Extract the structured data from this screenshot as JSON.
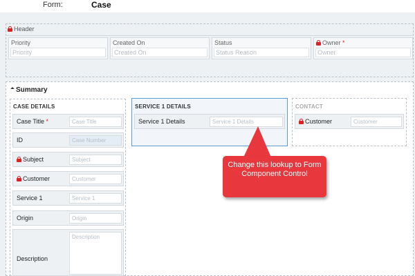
{
  "form": {
    "label": "Form:",
    "name": "Case"
  },
  "header": {
    "title": "Header",
    "fields": [
      {
        "label": "Priority",
        "placeholder": "Priority"
      },
      {
        "label": "Created On",
        "placeholder": "Created On"
      },
      {
        "label": "Status",
        "placeholder": "Status Reason"
      },
      {
        "label": "Owner",
        "placeholder": "Owner",
        "required": "*"
      }
    ]
  },
  "summary": {
    "title": "Summary",
    "case_details": {
      "title": "CASE DETAILS",
      "rows": [
        {
          "label": "Case Title",
          "placeholder": "Case Title",
          "required": "*"
        },
        {
          "label": "ID",
          "placeholder": "Case Number"
        },
        {
          "label": "Subject",
          "placeholder": "Subject"
        },
        {
          "label": "Customer",
          "placeholder": "Customer"
        },
        {
          "label": "Service 1",
          "placeholder": "Service 1"
        },
        {
          "label": "Origin",
          "placeholder": "Origin"
        },
        {
          "label": "Description",
          "placeholder": "Description"
        }
      ]
    },
    "service_details": {
      "title": "SERVICE 1 DETAILS",
      "rows": [
        {
          "label": "Service 1 Details",
          "placeholder": "Service 1 Details"
        }
      ]
    },
    "contact": {
      "title": "CONTACT",
      "rows": [
        {
          "label": "Customer",
          "placeholder": "Customer"
        }
      ]
    }
  },
  "callout": {
    "text": "Change this lookup to Form Component Control"
  },
  "colors": {
    "callout": "#e8383e",
    "required": "#dd2222",
    "selected_border": "#5a9bd5"
  }
}
